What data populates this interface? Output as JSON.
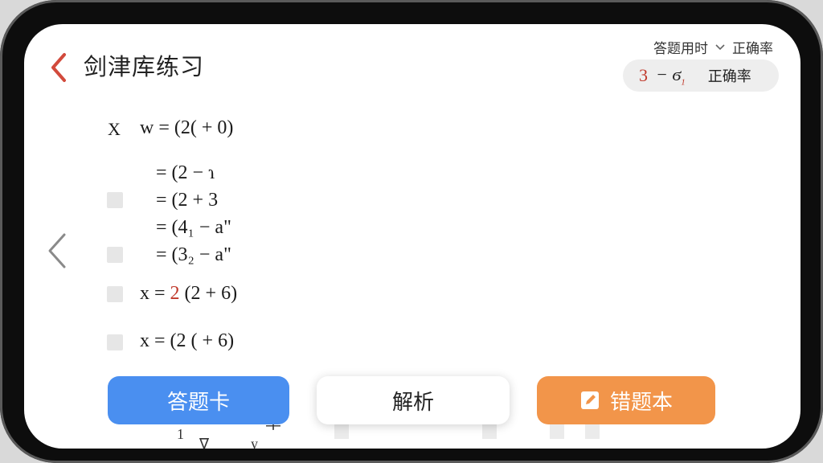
{
  "header": {
    "title": "剑津库练习",
    "stats_label_1": "答题用时",
    "stats_label_2": "正确率",
    "pill": {
      "number": "3",
      "expr": "− ϭ",
      "sub": "1",
      "label": "正确率"
    }
  },
  "question": {
    "marker": "X",
    "stem": "w = (2( + 0)"
  },
  "steps": [
    "= (2 − ɿ",
    "= (2 + 3",
    "= (4₁ − a\"",
    "= (3₂ − a\""
  ],
  "options": [
    {
      "prefix": "x = ",
      "highlight": "2",
      "rest": " (2  + 6)"
    },
    {
      "prefix": "x = ",
      "highlight": "",
      "rest": "(2 ( + 6)"
    }
  ],
  "buttons": {
    "answer_card": "答题卡",
    "analysis": "解析",
    "wrong_book": "错题本"
  },
  "ghost": {
    "a": "1",
    "b": "ψ",
    "c": "率",
    "d": "y",
    "e": "∇"
  },
  "colors": {
    "accent_blue": "#4a8ff0",
    "accent_orange": "#f2954a",
    "accent_red": "#c0392b"
  }
}
